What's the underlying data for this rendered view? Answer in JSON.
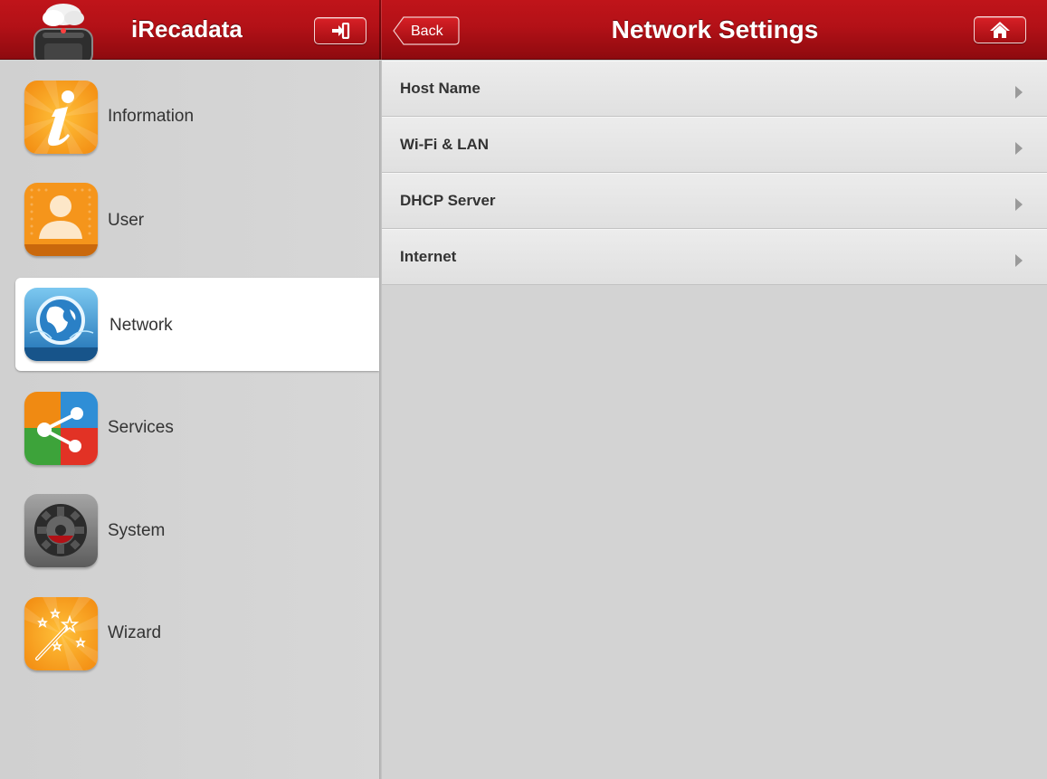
{
  "app": {
    "title": "iRecadata"
  },
  "header": {
    "back_label": "Back",
    "page_title": "Network Settings",
    "logout_icon": "logout-icon",
    "home_icon": "home-icon",
    "accent_color": "#b31117"
  },
  "sidebar": {
    "items": [
      {
        "label": "Information",
        "icon": "information-icon",
        "active": false
      },
      {
        "label": "User",
        "icon": "user-icon",
        "active": false
      },
      {
        "label": "Network",
        "icon": "globe-icon",
        "active": true
      },
      {
        "label": "Services",
        "icon": "share-icon",
        "active": false
      },
      {
        "label": "System",
        "icon": "gear-icon",
        "active": false
      },
      {
        "label": "Wizard",
        "icon": "magic-wand-icon",
        "active": false
      }
    ]
  },
  "settings": {
    "rows": [
      {
        "label": "Host Name"
      },
      {
        "label": "Wi-Fi & LAN"
      },
      {
        "label": "DHCP Server"
      },
      {
        "label": "Internet"
      }
    ]
  }
}
